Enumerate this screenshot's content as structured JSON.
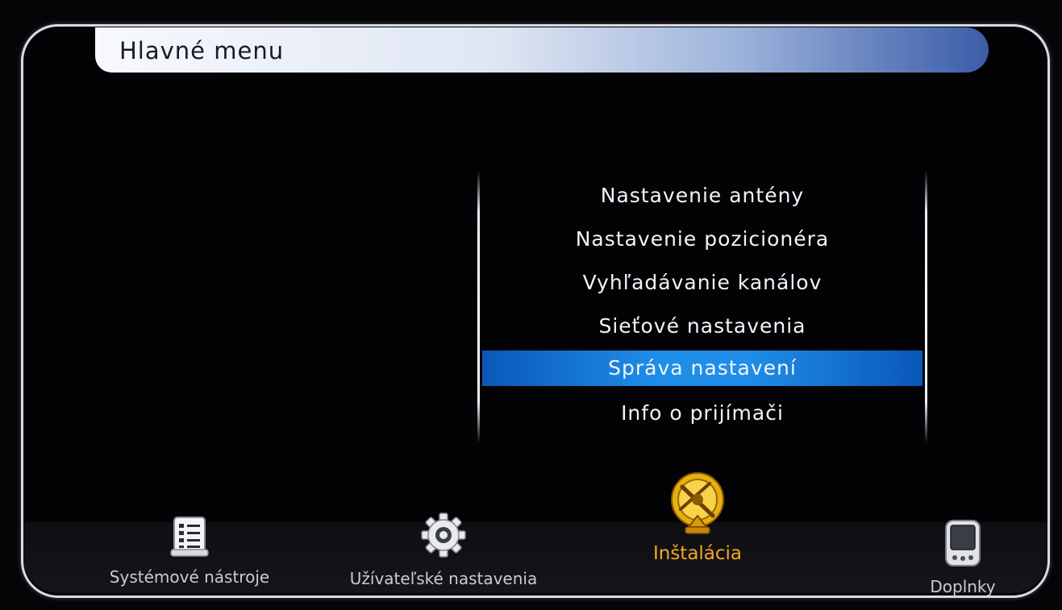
{
  "header": {
    "title": "Hlavné menu"
  },
  "menu": {
    "items": [
      {
        "label": "Nastavenie antény"
      },
      {
        "label": "Nastavenie pozicionéra"
      },
      {
        "label": "Vyhľadávanie kanálov"
      },
      {
        "label": "Sieťové nastavenia"
      },
      {
        "label": "Správa nastavení",
        "selected": true
      },
      {
        "label": "Info o prijímači"
      }
    ]
  },
  "bottom_nav": {
    "items": [
      {
        "label": "Systémové nástroje",
        "icon": "list-icon"
      },
      {
        "label": "Užívateľské nastavenia",
        "icon": "gear-icon"
      },
      {
        "label": "Inštalácia",
        "icon": "satellite-dish-icon",
        "active": true
      },
      {
        "label": "Doplnky",
        "icon": "handheld-device-icon"
      }
    ]
  },
  "colors": {
    "highlight": "#1e8ee8",
    "active_label": "#f5a623",
    "text": "#f2f4f8"
  }
}
